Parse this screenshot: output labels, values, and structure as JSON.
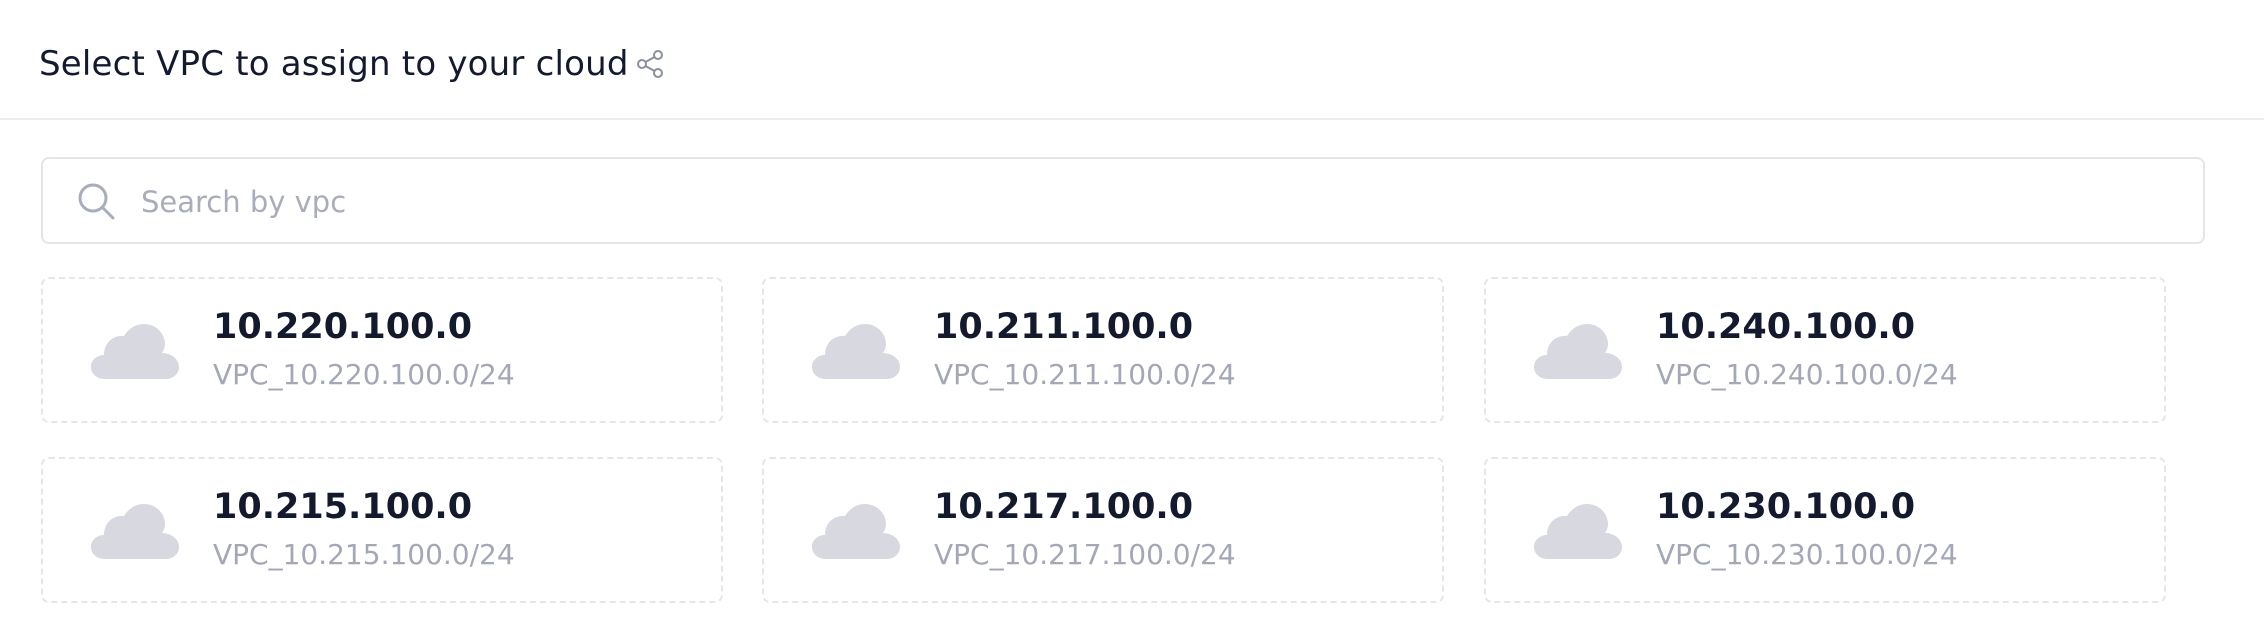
{
  "header": {
    "title": "Select VPC to assign to your cloud",
    "share_icon": "share-icon"
  },
  "search": {
    "placeholder": "Search by vpc",
    "value": "",
    "icon": "search-icon"
  },
  "vpcs": [
    {
      "ip": "10.220.100.0",
      "name": "VPC_10.220.100.0/24",
      "icon": "cloud-icon"
    },
    {
      "ip": "10.211.100.0",
      "name": "VPC_10.211.100.0/24",
      "icon": "cloud-icon"
    },
    {
      "ip": "10.240.100.0",
      "name": "VPC_10.240.100.0/24",
      "icon": "cloud-icon"
    },
    {
      "ip": "10.215.100.0",
      "name": "VPC_10.215.100.0/24",
      "icon": "cloud-icon"
    },
    {
      "ip": "10.217.100.0",
      "name": "VPC_10.217.100.0/24",
      "icon": "cloud-icon"
    },
    {
      "ip": "10.230.100.0",
      "name": "VPC_10.230.100.0/24",
      "icon": "cloud-icon"
    }
  ],
  "colors": {
    "text_primary": "#141a2e",
    "text_secondary": "#a3a7b6",
    "cloud": "#d7d8e0",
    "border": "#e4e6ec"
  }
}
